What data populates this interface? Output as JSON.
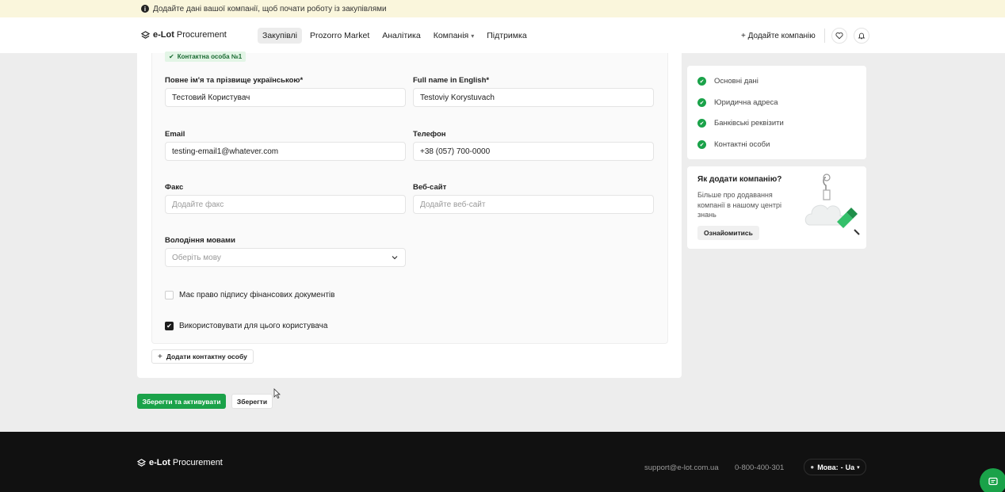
{
  "banner": {
    "text": "Додайте дані вашої компанії, щоб почати роботу із закупівлями",
    "icon": "info-icon"
  },
  "header": {
    "logo_bold": "e-Lot",
    "logo_rest": "Procurement",
    "nav": [
      {
        "label": "Закупівлі",
        "active": true
      },
      {
        "label": "Prozorro Market"
      },
      {
        "label": "Аналітика"
      },
      {
        "label": "Компанія",
        "has_dropdown": true
      },
      {
        "label": "Підтримка"
      }
    ],
    "add_company": "+ Додайте компанію",
    "icons": [
      "heart-icon",
      "bell-icon"
    ]
  },
  "form": {
    "contact_tag": "Контактна особа №1",
    "fields": {
      "full_name_ua": {
        "label": "Повне ім'я та прізвище українською*",
        "value": "Тестовий Користувач"
      },
      "full_name_en": {
        "label": "Full name in English*",
        "value": "Testoviy Korystuvach"
      },
      "email": {
        "label": "Email",
        "value": "testing-email1@whatever.com"
      },
      "phone": {
        "label": "Телефон",
        "value": "+38 (057) 700-0000"
      },
      "fax": {
        "label": "Факс",
        "placeholder": "Додайте факс"
      },
      "website": {
        "label": "Веб-сайт",
        "placeholder": "Додайте веб-сайт"
      },
      "languages": {
        "label": "Володіння мовами",
        "placeholder": "Оберіть мову"
      }
    },
    "checkboxes": [
      {
        "label": "Має право підпису фінансових документів",
        "checked": false
      },
      {
        "label": "Використовувати для цього користувача",
        "checked": true
      }
    ],
    "add_contact": "Додати контактну особу",
    "save_activate": "Зберегти та активувати",
    "save": "Зберегти"
  },
  "sidebar": {
    "steps": [
      {
        "label": "Основні дані",
        "done": true
      },
      {
        "label": "Юридична адреса",
        "done": true
      },
      {
        "label": "Банківські реквізити",
        "done": true
      },
      {
        "label": "Контактні особи",
        "done": true
      }
    ],
    "help": {
      "title": "Як додати компанію?",
      "text": "Більше про додавання компанії в нашому центрі знань",
      "button": "Ознайомитись"
    }
  },
  "footer": {
    "logo_bold": "e-Lot",
    "logo_rest": "Procurement",
    "email": "support@e-lot.com.ua",
    "phone": "0-800-400-301",
    "lang_label": "Мова:",
    "lang_value": "Ua"
  },
  "colors": {
    "accent": "#1aa249",
    "footer_bg": "#111111",
    "banner_bg": "#faf6dc"
  }
}
